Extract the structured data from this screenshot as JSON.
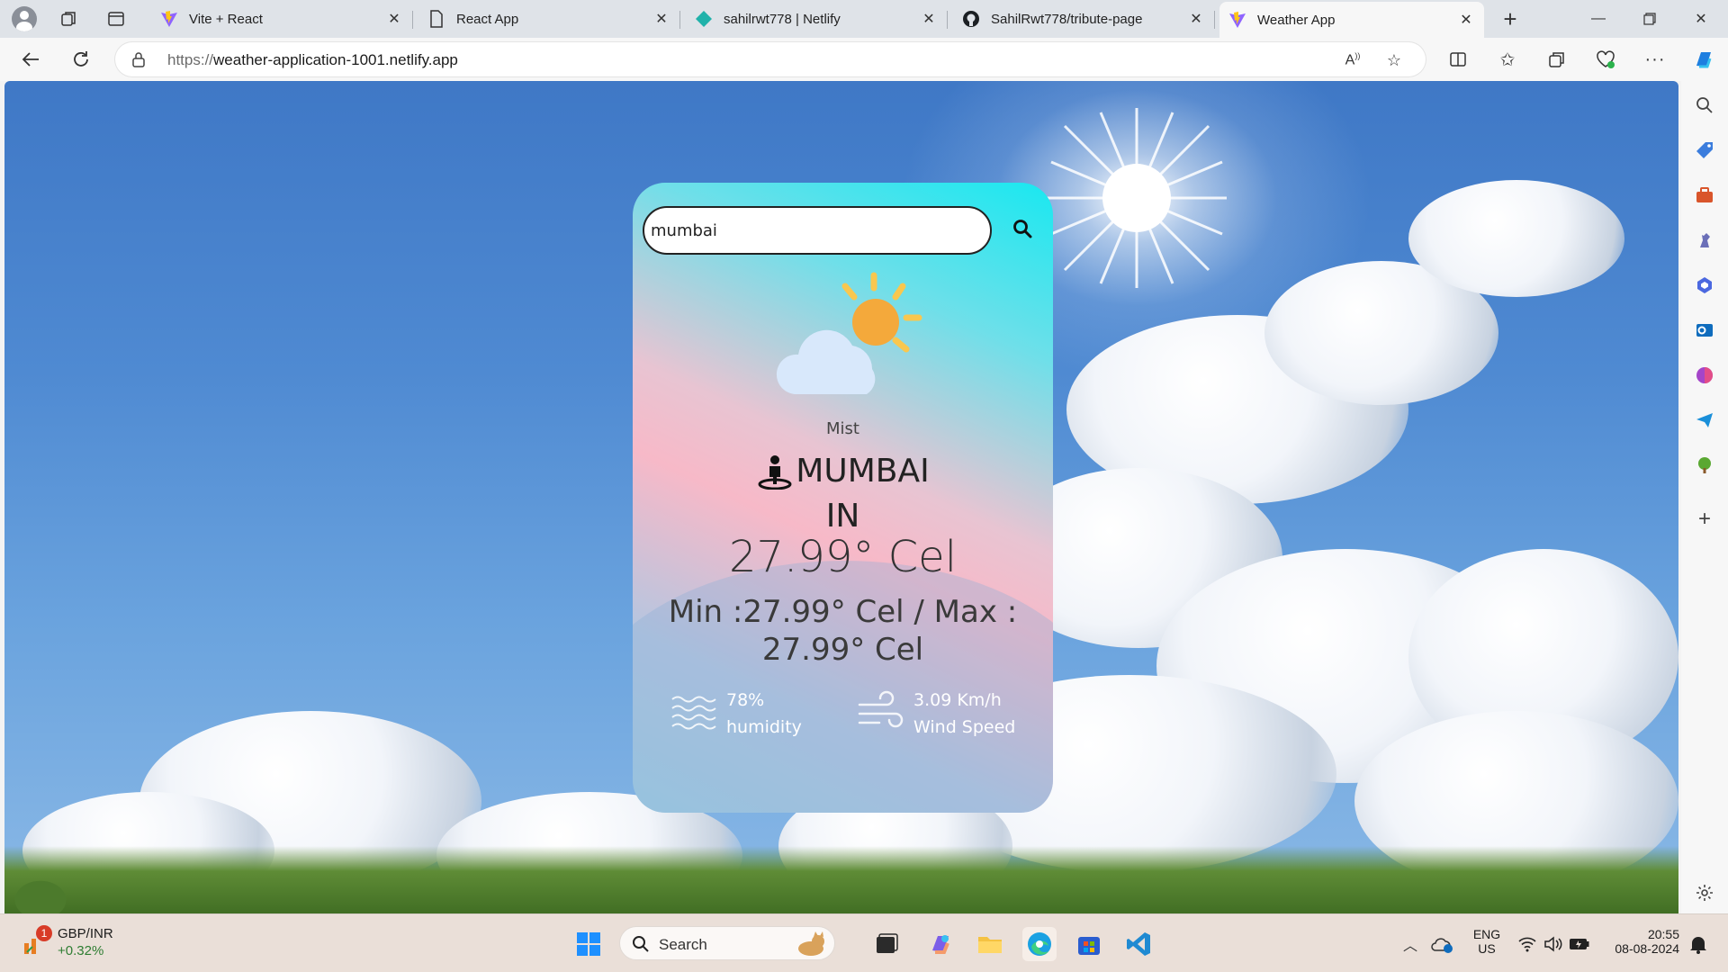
{
  "browser": {
    "tabs": [
      {
        "title": "Vite + React",
        "icon": "vite-icon"
      },
      {
        "title": "React App",
        "icon": "page-icon"
      },
      {
        "title": "sahilrwt778 | Netlify",
        "icon": "netlify-icon"
      },
      {
        "title": "SahilRwt778/tribute-page",
        "icon": "github-icon"
      },
      {
        "title": "Weather App",
        "icon": "vite-icon",
        "active": true
      }
    ],
    "url_prefix": "https://",
    "url_host": "weather-application-1001.netlify.app"
  },
  "weather": {
    "search_value": "mumbai",
    "condition": "Mist",
    "city": "MUMBAI",
    "country": "IN",
    "temperature": "27.99° Cel",
    "min_max": "Min :27.99° Cel / Max : 27.99° Cel",
    "humidity_value": "78%",
    "humidity_label": "humidity",
    "wind_value": "3.09 Km/h",
    "wind_label": "Wind Speed"
  },
  "taskbar": {
    "widget_title": "GBP/INR",
    "widget_change": "+0.32%",
    "widget_badge": "1",
    "search_label": "Search",
    "lang_top": "ENG",
    "lang_bottom": "US",
    "time": "20:55",
    "date": "08-08-2024"
  },
  "colors": {
    "card_top": "#19e8f0",
    "card_mid": "#f7b9c8",
    "sky": "#4f8ad2",
    "edge_accent": "#0078d4"
  }
}
